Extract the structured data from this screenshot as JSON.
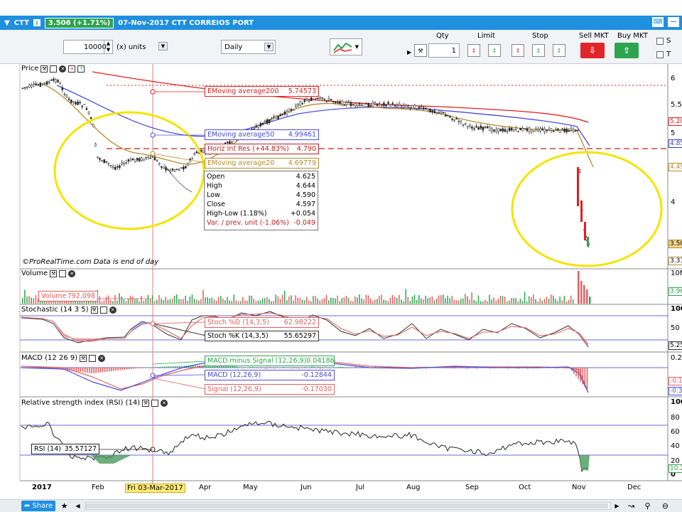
{
  "titlebar": {
    "symbol": "CTT",
    "price_change": "3.506 (+1.71%)",
    "description": "07-Nov-2017 CTT CORREIOS PORT",
    "info_icon": "info-icon"
  },
  "toolbar": {
    "quantity_value": "10000",
    "units_label": "(x) units",
    "period_value": "Daily",
    "order_headers": [
      "Qty",
      "Limit",
      "Stop",
      "Sell MKT",
      "Buy MKT"
    ],
    "qty_value": "1",
    "checkbox_s": "S",
    "checkbox_t": "T",
    "sell_color": "#e0262a",
    "buy_color": "#2ea44f"
  },
  "price_panel": {
    "title": "Price",
    "watermark": "©ProRealTime.com  Data is end of day",
    "indicators": {
      "ema200_label": "EMoving average200",
      "ema200_value": "5.74573",
      "ema50_label": "EMoving average50",
      "ema50_value": "4.99461",
      "horiz_label": "Horiz Int Res (+44.83%)",
      "horiz_value": "4.790",
      "ema20_label": "EMoving average20",
      "ema20_value": "4.69779"
    },
    "ohlc": {
      "open_label": "Open",
      "open_value": "4.625",
      "high_label": "High",
      "high_value": "4.644",
      "low_label": "Low",
      "low_value": "4.590",
      "close_label": "Close",
      "close_value": "4.597",
      "hl_label": "High-Low (1.18%)",
      "hl_value": "+0.054",
      "var_label": "Var. / prev. unit (-1.06%)",
      "var_value": "-0.049"
    },
    "axis_labels": [
      "6",
      "5.5",
      "5",
      "4",
      "3.5"
    ],
    "right_tags": [
      "5.20",
      "4.85",
      "4.49",
      "3.50",
      "3.31"
    ]
  },
  "volume_panel": {
    "title": "Volume",
    "label": "Volume",
    "value": "792,098",
    "axis_labels": [
      "10M",
      "3.96"
    ]
  },
  "stochastic_panel": {
    "title": "Stochastic (14 3 5)",
    "d_label": "Stoch %D (14,3,5)",
    "d_value": "62.98222",
    "k_label": "Stoch %K (14,3,5)",
    "k_value": "55.65297",
    "axis_labels": [
      "100",
      "50",
      "5.25"
    ]
  },
  "macd_panel": {
    "title": "MACD (12 26 9)",
    "hist_label": "MACD minus Signal (12,26,9)",
    "hist_value": "0.04186",
    "macd_label": "MACD (12,26,9)",
    "macd_value": "-0.12844",
    "signal_label": "Signal (12,26,9)",
    "signal_value": "-0.17030",
    "axis_labels": [
      "0.2",
      "-0.1",
      "-0.3"
    ]
  },
  "rsi_panel": {
    "title": "Relative strength index (RSI) (14)",
    "label": "RSI (14)",
    "value": "35.57127",
    "axis_labels": [
      "100",
      "80",
      "60",
      "40",
      "20",
      "0",
      "10.2"
    ]
  },
  "time_axis": {
    "months": [
      "2017",
      "Feb",
      "Apr",
      "May",
      "Jun",
      "Jul",
      "Aug",
      "Sep",
      "Oct",
      "Nov",
      "Dec"
    ],
    "cursor_date": "Fri 03-Mar-2017"
  },
  "bottombar": {
    "share_label": "Share"
  },
  "colors": {
    "titlebar": "#1f8fe0",
    "ema200": "#e02020",
    "ema50": "#4b4bd8",
    "ema20": "#b58a2c",
    "highlight_circle": "#f5e400"
  }
}
